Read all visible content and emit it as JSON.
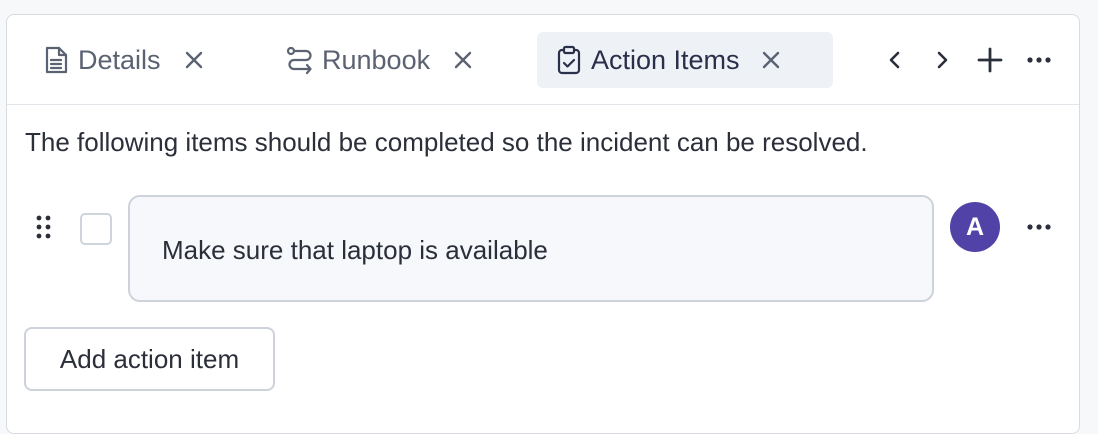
{
  "tabs": [
    {
      "label": "Details",
      "icon": "document-icon",
      "active": false
    },
    {
      "label": "Runbook",
      "icon": "route-icon",
      "active": false
    },
    {
      "label": "Action Items",
      "icon": "clipboard-check-icon",
      "active": true
    }
  ],
  "tabbar_controls": [
    "chevron-left-icon",
    "chevron-right-icon",
    "plus-icon",
    "more-horizontal-icon"
  ],
  "intro_text": "The following items should be completed so the incident can be resolved.",
  "action_items": [
    {
      "text": "Make sure that laptop is available",
      "checked": false,
      "assignee_initial": "A"
    }
  ],
  "add_button_label": "Add action item",
  "colors": {
    "avatar": "#5142a8",
    "active_tab_bg": "#eef1f6",
    "item_bg": "#f6f8fb"
  }
}
